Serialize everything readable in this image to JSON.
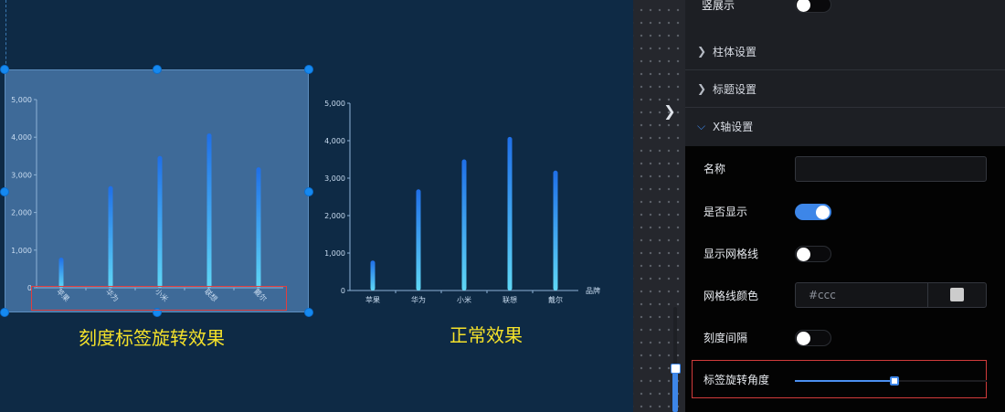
{
  "captions": {
    "rotated": "刻度标签旋转效果",
    "normal": "正常效果"
  },
  "chart_data": [
    {
      "type": "bar",
      "categories": [
        "苹果",
        "华为",
        "小米",
        "联想",
        "戴尔"
      ],
      "values": [
        800,
        2700,
        3500,
        4100,
        3200
      ],
      "y_ticks": [
        "0",
        "1,000",
        "2,000",
        "3,000",
        "4,000",
        "5,000"
      ],
      "ylim": [
        0,
        5000
      ],
      "xlabel": "",
      "x_label_rotation_deg": 45,
      "bar_color_top": "#1f6fe8",
      "bar_color_bottom": "#5fd7f5"
    },
    {
      "type": "bar",
      "categories": [
        "苹果",
        "华为",
        "小米",
        "联想",
        "戴尔"
      ],
      "values": [
        800,
        2700,
        3500,
        4100,
        3200
      ],
      "y_ticks": [
        "0",
        "1,000",
        "2,000",
        "3,000",
        "4,000",
        "5,000"
      ],
      "ylim": [
        0,
        5000
      ],
      "xlabel": "品牌",
      "x_label_rotation_deg": 0,
      "bar_color_top": "#1f6fe8",
      "bar_color_bottom": "#5fd7f5"
    }
  ],
  "panel": {
    "display_label": "竖展示",
    "display_on": false,
    "sections": [
      {
        "label": "柱体设置",
        "expanded": false
      },
      {
        "label": "标题设置",
        "expanded": false
      },
      {
        "label": "X轴设置",
        "expanded": true
      }
    ],
    "xaxis": {
      "name_label": "名称",
      "name_value": "",
      "show_label": "是否显示",
      "show_on": true,
      "grid_label": "显示网格线",
      "grid_on": false,
      "grid_color_label": "网格线颜色",
      "grid_color_value": "#ccc",
      "tick_interval_label": "刻度间隔",
      "tick_interval_on": false,
      "rotate_label": "标签旋转角度",
      "rotate_value_fraction": 0.52
    }
  },
  "icons": {
    "panel_toggle": "chevron-right-icon",
    "section_collapsed": "chevron-right-icon",
    "section_expanded": "chevron-down-icon"
  },
  "colors": {
    "accent": "#3d86e8",
    "caption": "#f5e22a",
    "highlight": "#e23e3e"
  }
}
